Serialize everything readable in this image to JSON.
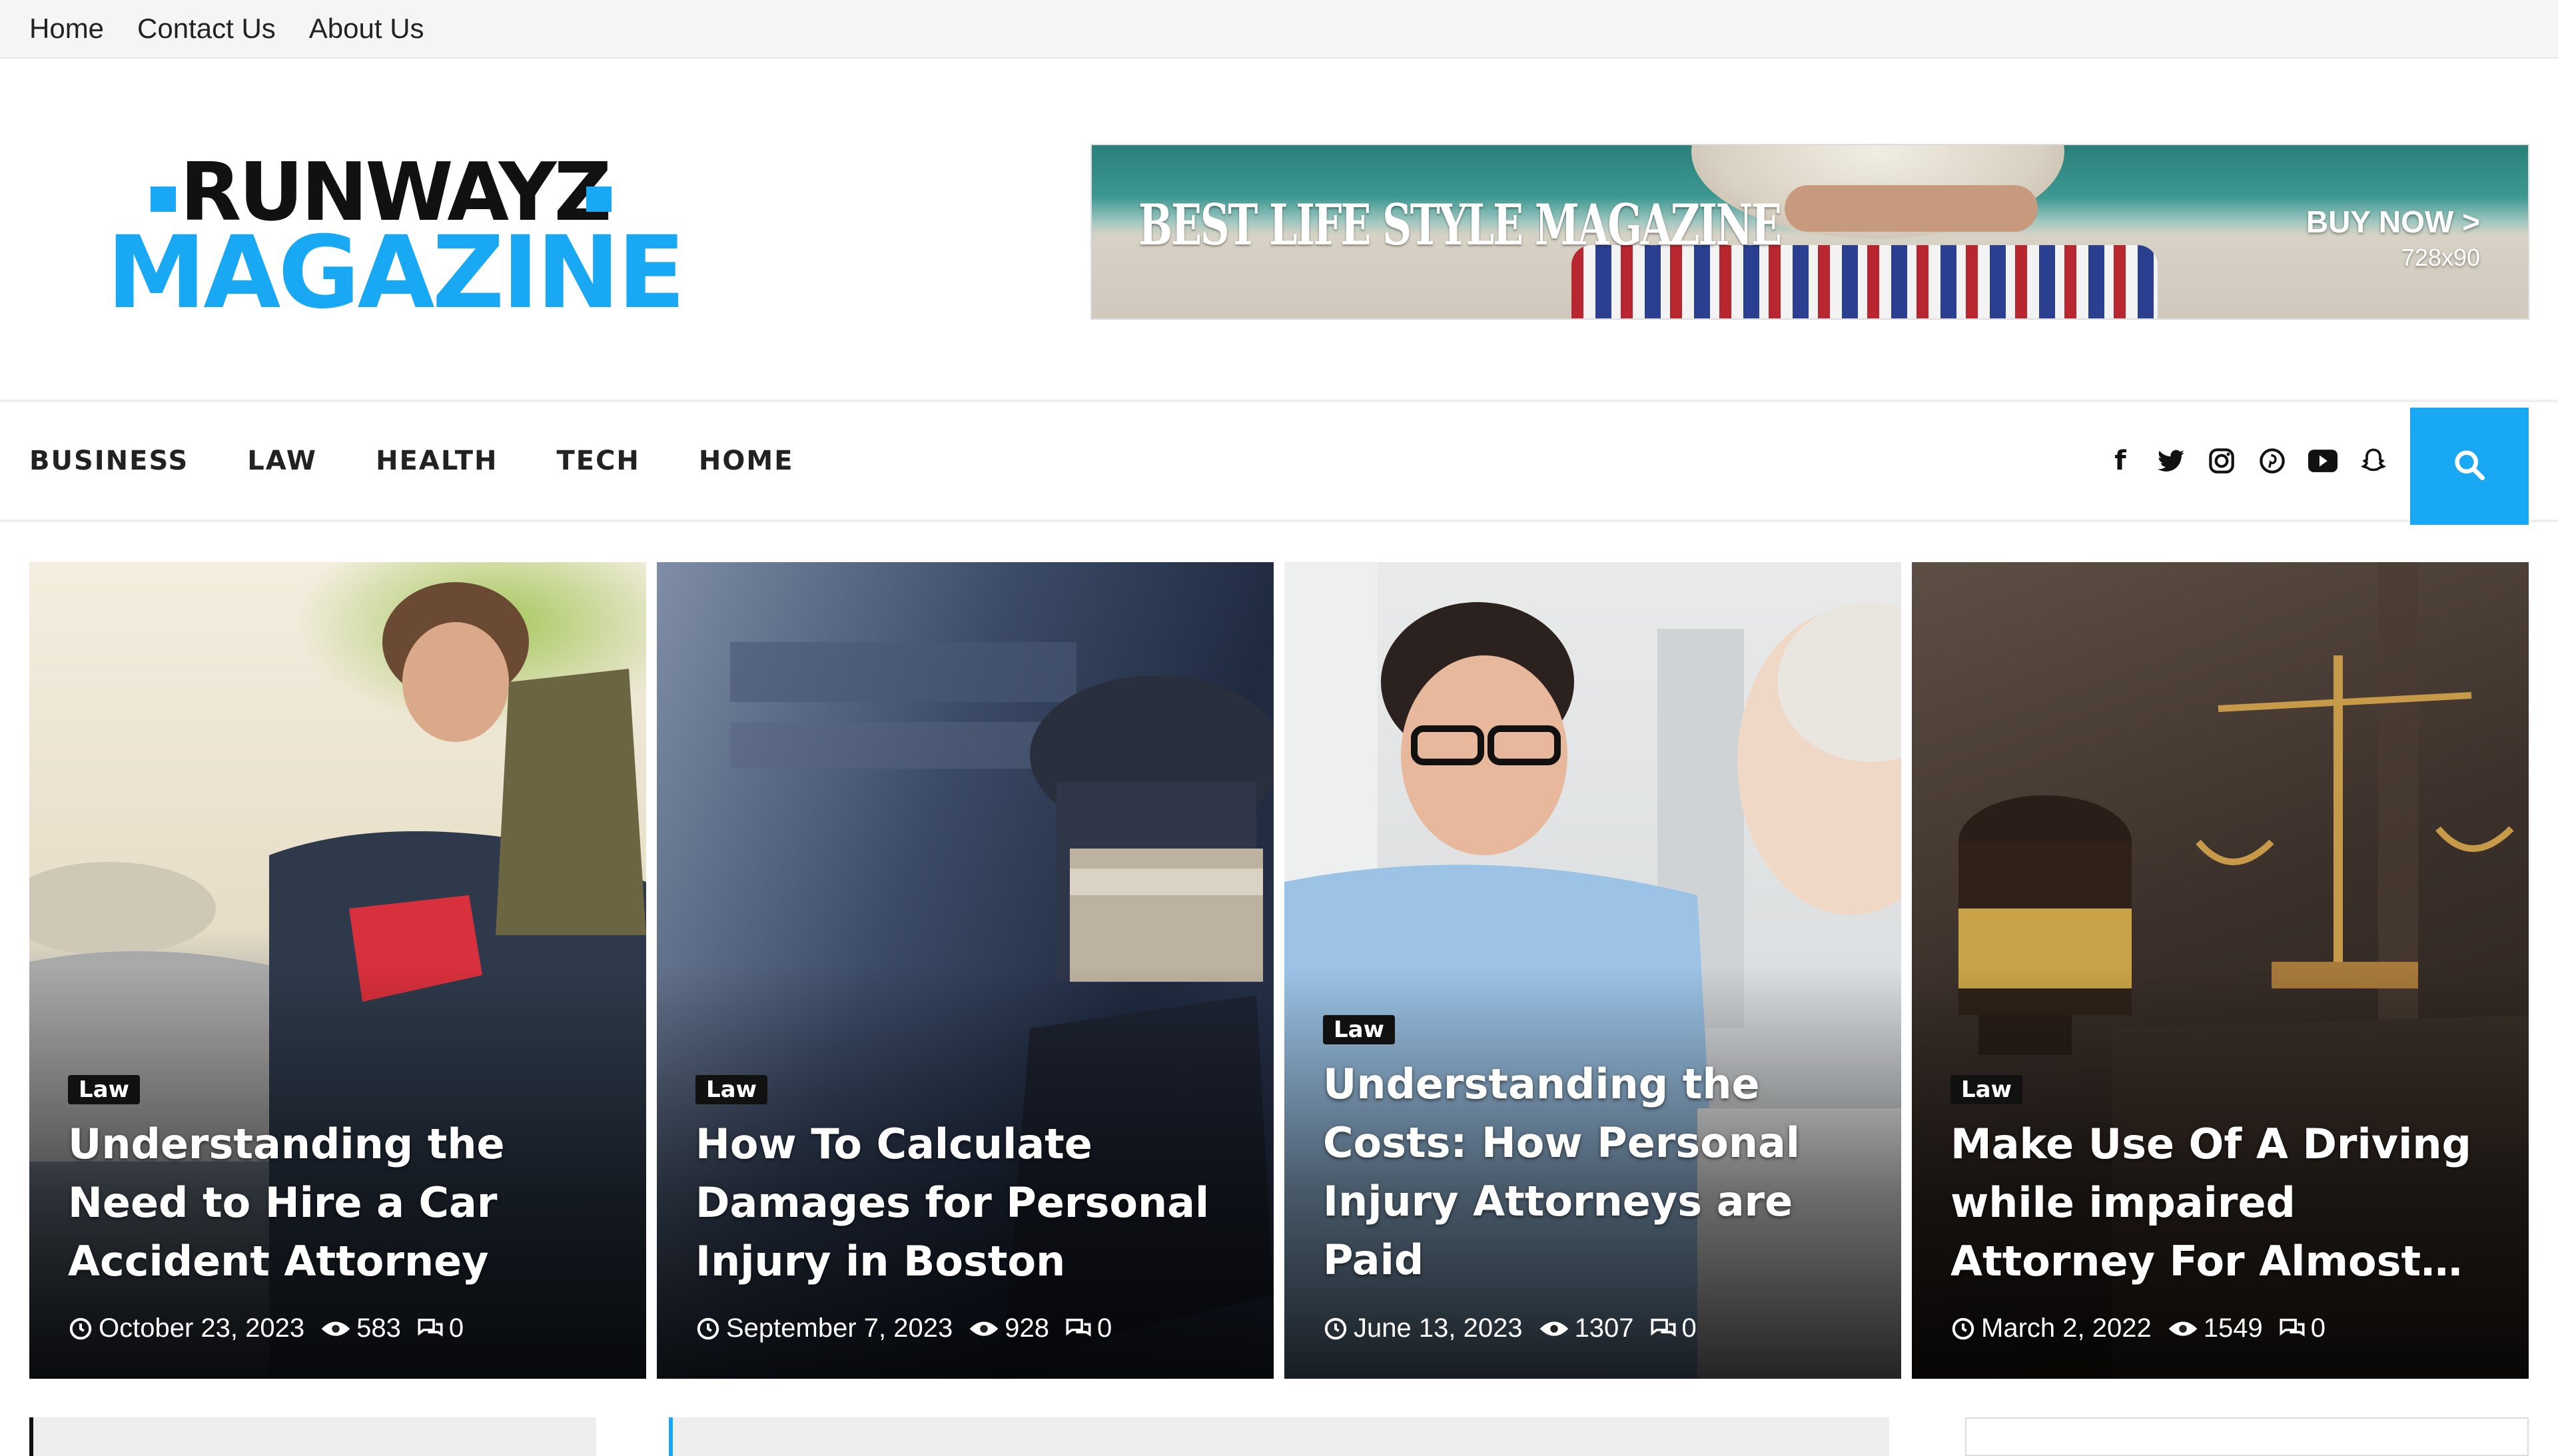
{
  "top_nav": [
    "Home",
    "Contact Us",
    "About Us"
  ],
  "logo": {
    "line1": "RUNWAYZ",
    "line2": "MAGAZINE"
  },
  "banner": {
    "headline": "BEST LIFE STYLE MAGAZINE",
    "cta": "BUY NOW >",
    "size": "728x90"
  },
  "main_nav": [
    "BUSINESS",
    "LAW",
    "HEALTH",
    "TECH",
    "HOME"
  ],
  "social_icons": [
    "facebook-icon",
    "twitter-icon",
    "instagram-icon",
    "pinterest-icon",
    "youtube-icon",
    "snapchat-icon"
  ],
  "colors": {
    "accent": "#19a9f4",
    "dark": "#111111"
  },
  "cards": [
    {
      "category": "Law",
      "title": "Understanding the Need to Hire a Car Accident Attorney",
      "date": "October 23, 2023",
      "views": "583",
      "comments": "0"
    },
    {
      "category": "Law",
      "title": "How To Calculate Damages for Personal Injury in Boston",
      "date": "September 7, 2023",
      "views": "928",
      "comments": "0"
    },
    {
      "category": "Law",
      "title": "Understanding the Costs: How Personal Injury Attorneys are Paid",
      "date": "June 13, 2023",
      "views": "1307",
      "comments": "0"
    },
    {
      "category": "Law",
      "title": "Make Use Of A Driving while impaired Attorney For Almost…",
      "date": "March 2, 2022",
      "views": "1549",
      "comments": "0"
    }
  ]
}
